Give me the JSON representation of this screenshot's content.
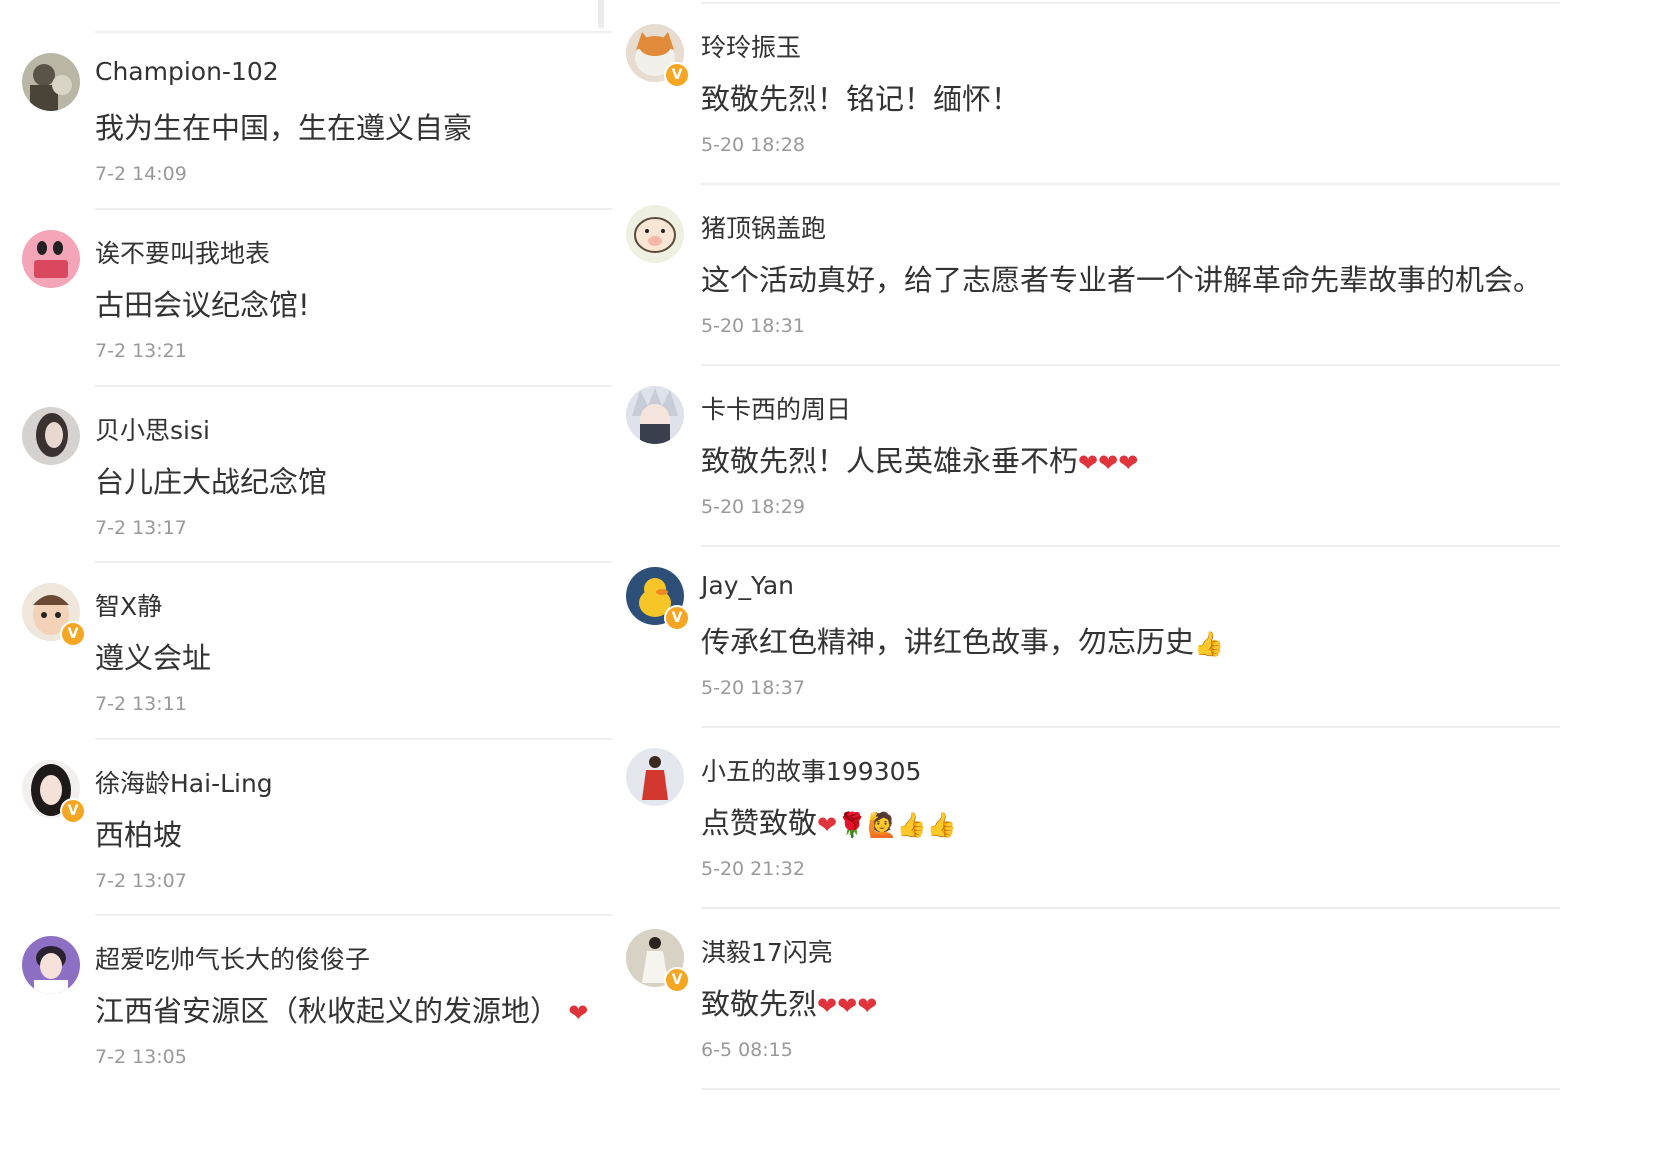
{
  "left_comments": [
    {
      "username": "Champion-102",
      "text": "我为生在中国，生在遵义自豪",
      "emoji": "",
      "time": "7-2 14:09",
      "avatar": "photo-avatar",
      "verified": false
    },
    {
      "username": "诶不要叫我地表",
      "text": "古田会议纪念馆!",
      "emoji": "",
      "time": "7-2 13:21",
      "avatar": "pink-cartoon-avatar",
      "verified": false
    },
    {
      "username": "贝小思sisi",
      "text": "台儿庄大战纪念馆",
      "emoji": "",
      "time": "7-2 13:17",
      "avatar": "girl-avatar",
      "verified": false
    },
    {
      "username": "智X静",
      "text": "遵义会址",
      "emoji": "",
      "time": "7-2 13:11",
      "avatar": "baby-avatar",
      "verified": true
    },
    {
      "username": "徐海龄Hai-Ling",
      "text": "西柏坡",
      "emoji": "",
      "time": "7-2 13:07",
      "avatar": "woman-avatar",
      "verified": true
    },
    {
      "username": "超爱吃帅气长大的俊俊子",
      "text": "江西省安源区（秋收起义的发源地）",
      "emoji": "❤",
      "time": "7-2 13:05",
      "avatar": "boy-avatar",
      "verified": false
    }
  ],
  "right_comments": [
    {
      "username": "玲玲振玉",
      "text": "致敬先烈！铭记！缅怀！",
      "emoji": "",
      "time": "5-20 18:28",
      "avatar": "cat-avatar",
      "verified": true
    },
    {
      "username": "猪顶锅盖跑",
      "text": "这个活动真好，给了志愿者专业者一个讲解革命先辈故事的机会。",
      "emoji": "",
      "time": "5-20 18:31",
      "avatar": "pig-cartoon-avatar",
      "verified": false
    },
    {
      "username": "卡卡西的周日",
      "text": "致敬先烈！人民英雄永垂不朽",
      "emoji": "❤❤❤",
      "time": "5-20 18:29",
      "avatar": "anime-avatar",
      "verified": false
    },
    {
      "username": "Jay_Yan",
      "text": "传承红色精神，讲红色故事，勿忘历史",
      "emoji": "👍",
      "time": "5-20 18:37",
      "avatar": "duck-avatar",
      "verified": true
    },
    {
      "username": "小五的故事199305",
      "text": "点赞致敬",
      "emoji": "❤🌹🙋👍👍",
      "time": "5-20 21:32",
      "avatar": "red-dress-avatar",
      "verified": false
    },
    {
      "username": "淇毅17闪亮",
      "text": "致敬先烈",
      "emoji": "❤❤❤",
      "time": "6-5 08:15",
      "avatar": "white-dress-avatar",
      "verified": true
    }
  ],
  "colors": {
    "divider": "#eeeeee",
    "text": "#333333",
    "time": "#999999",
    "verified_badge": "#f5a623",
    "heart": "#e0343c"
  }
}
